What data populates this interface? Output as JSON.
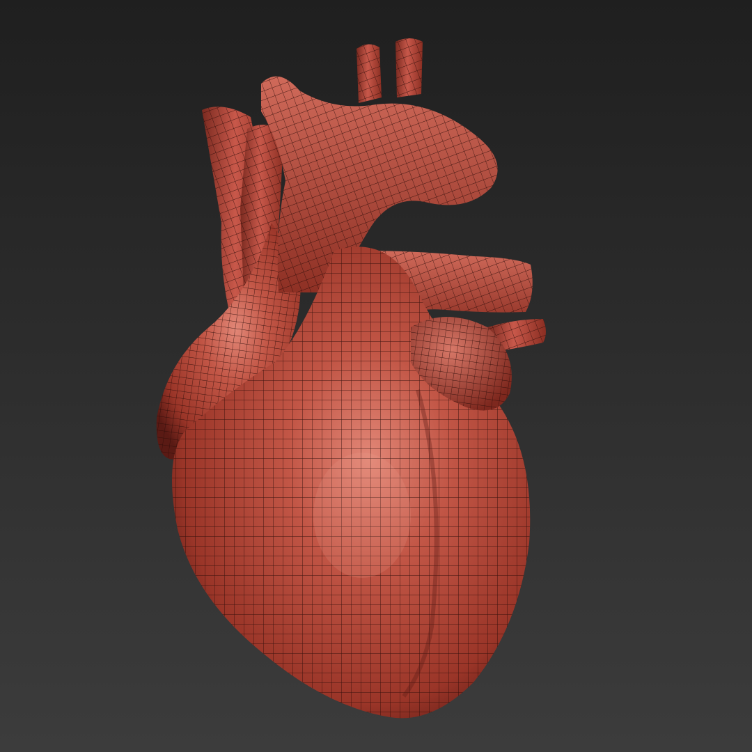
{
  "viewport": {
    "corner_label": "",
    "background_top": "#1f1f1f",
    "background_bottom": "#3c3c3c"
  },
  "model": {
    "subject": "heart-icon",
    "surface_color": "#b84a3c",
    "highlight_color": "#e08070",
    "shadow_color": "#5a1a14",
    "wire_color": "#2a0c08",
    "display_mode": "wireframe-on-shaded"
  }
}
